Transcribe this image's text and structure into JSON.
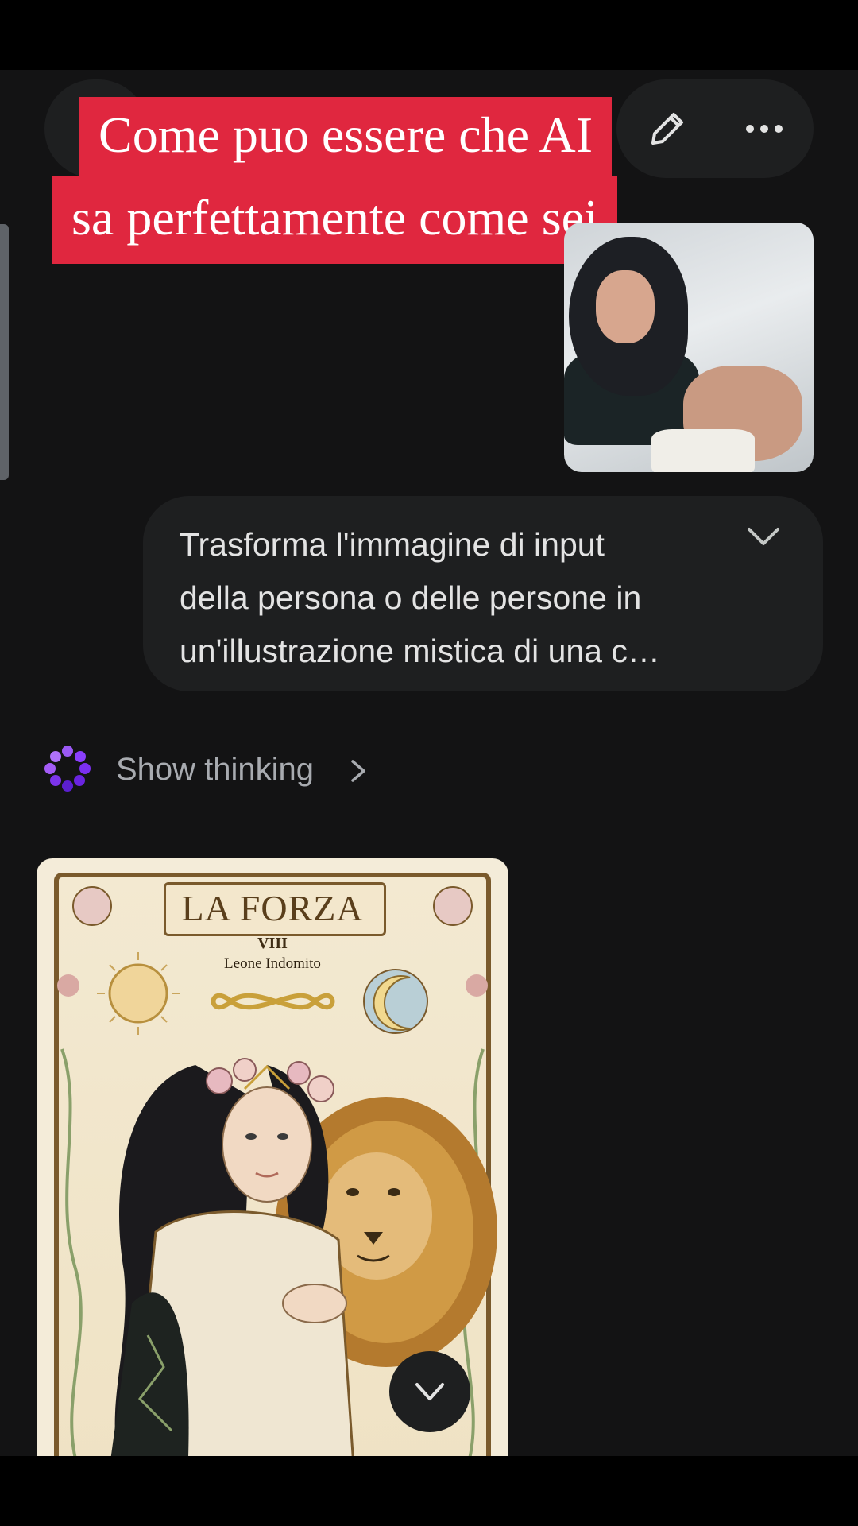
{
  "caption": {
    "line1": "Come puo essere che AI",
    "line2": "sa perfettamente come sei"
  },
  "header": {
    "left_icon": "menu-icon",
    "edit_icon": "edit-icon",
    "more_icon": "more-icon"
  },
  "user_message": {
    "image": "user-photo",
    "prompt": "Trasforma l'immagine di input\ndella persona o delle persone in\nun'illustrazione mistica di una c…",
    "expand_icon": "chevron-down-icon"
  },
  "response": {
    "thinking_label": "Show thinking",
    "thinking_icon": "gemini-spark-icon"
  },
  "tarot_card": {
    "title": "LA FORZA",
    "number": "VIII",
    "subtitle": "Leone Indomito"
  },
  "colors": {
    "background": "#131314",
    "bubble": "#1e1f20",
    "caption_bg": "#e0273f",
    "accent_purple": "#8a3ffc"
  }
}
